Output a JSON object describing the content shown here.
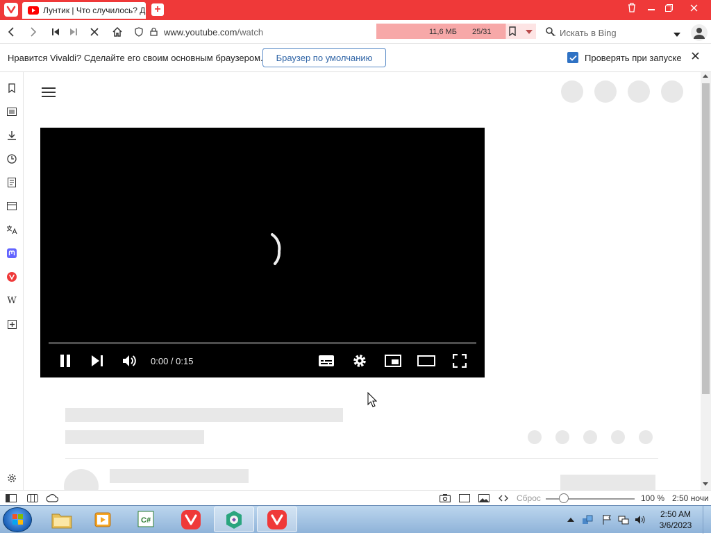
{
  "browser": {
    "tab_title": "Лунтик | Что случилось? Д",
    "url_prefix": "www.youtube.com",
    "url_path": "/watch",
    "load_size": "11,6 МБ",
    "load_count": "25/31",
    "load_progress": 0.81,
    "search_placeholder": "Искать в Bing"
  },
  "notification": {
    "text": "Нравится Vivaldi? Сделайте его своим основным браузером.",
    "default_button": "Браузер по умолчанию",
    "check_label": "Проверять при запуске",
    "checked": true
  },
  "player": {
    "time": "0:00 / 0:15",
    "progress": 0
  },
  "statusbar": {
    "reset_label": "Сброс",
    "zoom_level": "100 %",
    "clock": "2:50 ночи"
  },
  "taskbar": {
    "time": "2:50 AM",
    "date": "3/6/2023",
    "items": [
      "file-explorer",
      "media-player",
      "csharp-editor",
      "vivaldi",
      "app-green",
      "vivaldi-active"
    ]
  },
  "colors": {
    "brand_red": "#ef3939",
    "accent_blue": "#2f72c4"
  }
}
